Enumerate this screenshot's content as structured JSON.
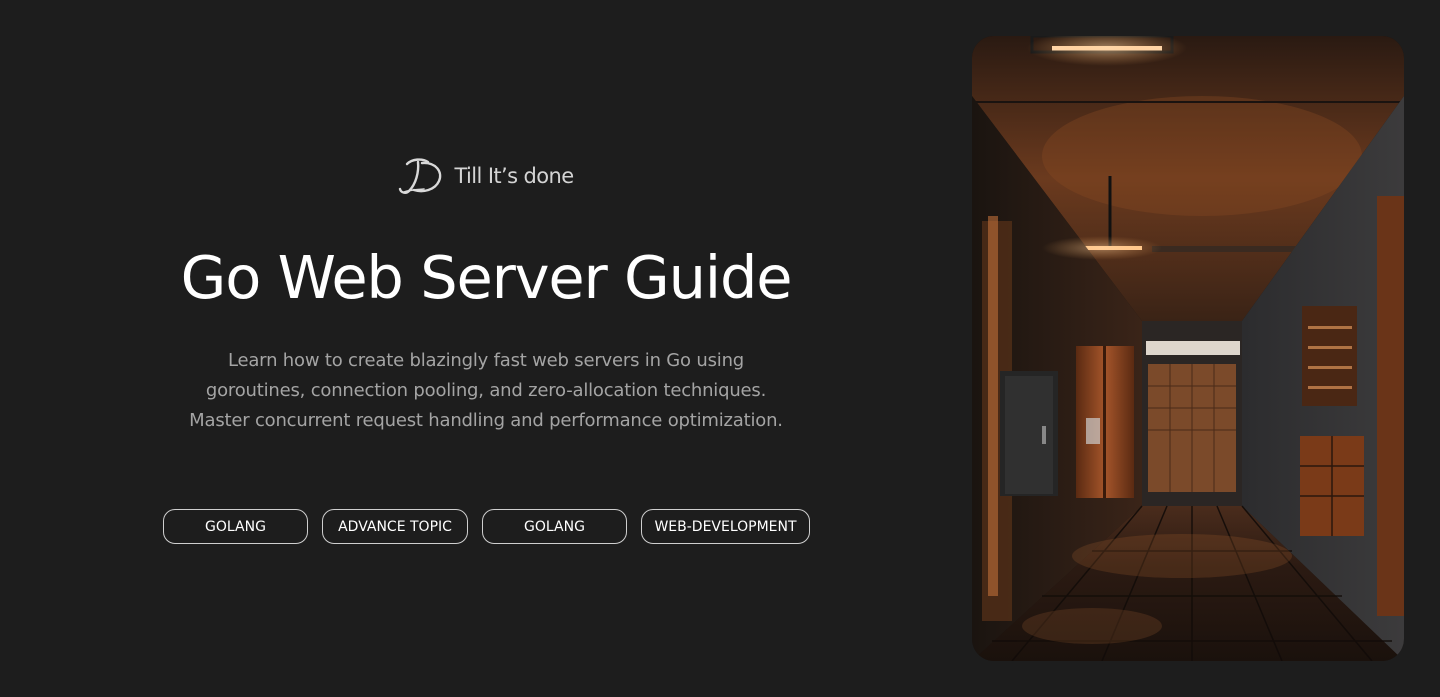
{
  "brand": {
    "name": "Till It’s done",
    "logo_icon": "signature-logo-icon"
  },
  "hero": {
    "title": "Go Web Server Guide",
    "description_lines": [
      "Learn how to create blazingly fast web servers in Go using",
      "goroutines, connection pooling, and zero-allocation techniques.",
      "Master concurrent request handling and performance optimization."
    ],
    "tags": [
      "GOLANG",
      "ADVANCE TOPIC",
      "GOLANG",
      "WEB-DEVELOPMENT"
    ]
  },
  "image": {
    "subject": "dark wood-paneled industrial corridor with warm ceiling lights"
  },
  "colors": {
    "background": "#1d1d1d",
    "title": "#ffffff",
    "description": "#a4a4a4",
    "tag_border": "#cfcfcf",
    "brand_text": "#d4d4d4"
  }
}
